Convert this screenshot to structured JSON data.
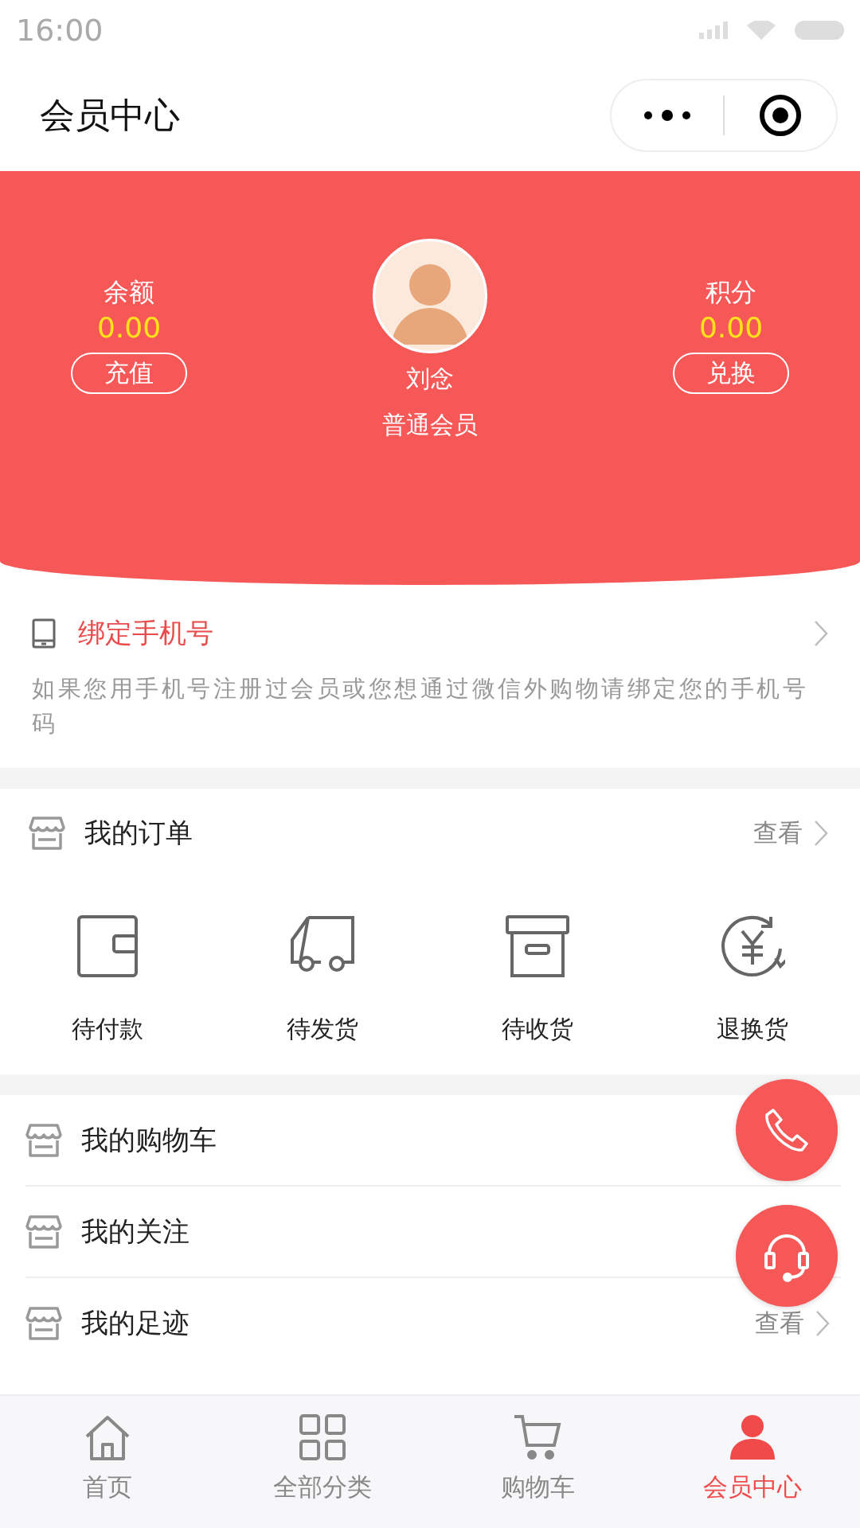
{
  "status_bar": {
    "time": "16:00"
  },
  "header": {
    "title": "会员中心"
  },
  "hero": {
    "stats": [
      {
        "label": "余额",
        "value": "0.00",
        "button": "充值"
      },
      {
        "label": "积分",
        "value": "0.00",
        "button": "兑换"
      }
    ],
    "user": {
      "name": "刘念",
      "level": "普通会员"
    }
  },
  "bind_phone": {
    "title": "绑定手机号",
    "description": "如果您用手机号注册过会员或您想通过微信外购物请绑定您的手机号码"
  },
  "orders": {
    "title": "我的订单",
    "action": "查看",
    "statuses": [
      {
        "kind": "wallet",
        "label": "待付款"
      },
      {
        "kind": "truck",
        "label": "待发货"
      },
      {
        "kind": "box",
        "label": "待收货"
      },
      {
        "kind": "refund",
        "label": "退换货"
      }
    ]
  },
  "menu": [
    {
      "label": "我的购物车"
    },
    {
      "label": "我的关注"
    },
    {
      "label": "我的足迹",
      "action": "查看"
    }
  ],
  "floating_buttons": [
    {
      "kind": "phone"
    },
    {
      "kind": "headset"
    }
  ],
  "tabs": [
    {
      "kind": "home",
      "label": "首页",
      "selected": false
    },
    {
      "kind": "grid",
      "label": "全部分类",
      "selected": false
    },
    {
      "kind": "cart",
      "label": "购物车",
      "selected": false
    },
    {
      "kind": "person",
      "label": "会员中心",
      "selected": true
    }
  ]
}
